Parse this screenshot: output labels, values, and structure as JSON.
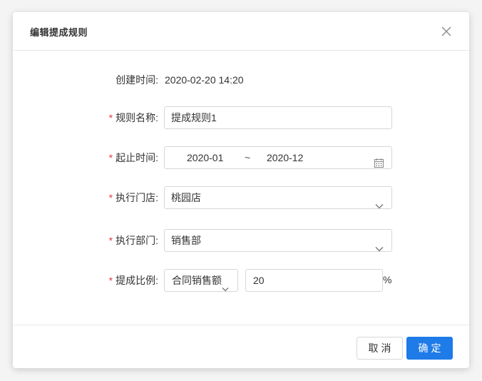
{
  "dialog": {
    "title": "编辑提成规则",
    "close_icon": "close-icon"
  },
  "form": {
    "created": {
      "label": "创建时间:",
      "value": "2020-02-20 14:20"
    },
    "rule_name": {
      "required_mark": "*",
      "label": "规则名称:",
      "value": "提成规则1"
    },
    "period": {
      "required_mark": "*",
      "label": "起止时间:",
      "start": "2020-01",
      "separator": "~",
      "end": "2020-12",
      "icon": "calendar-icon"
    },
    "store": {
      "required_mark": "*",
      "label": "执行门店:",
      "value": "桃园店",
      "icon": "chevron-down-icon"
    },
    "department": {
      "required_mark": "*",
      "label": "执行部门:",
      "value": "销售部",
      "icon": "chevron-down-icon"
    },
    "ratio": {
      "required_mark": "*",
      "label": "提成比例:",
      "basis": "合同销售额",
      "value": "20",
      "unit": "%"
    }
  },
  "footer": {
    "cancel_label": "取消",
    "ok_label": "确定"
  },
  "colors": {
    "primary": "#1f7be8",
    "required": "#e4393c",
    "border": "#d7d7d7"
  }
}
